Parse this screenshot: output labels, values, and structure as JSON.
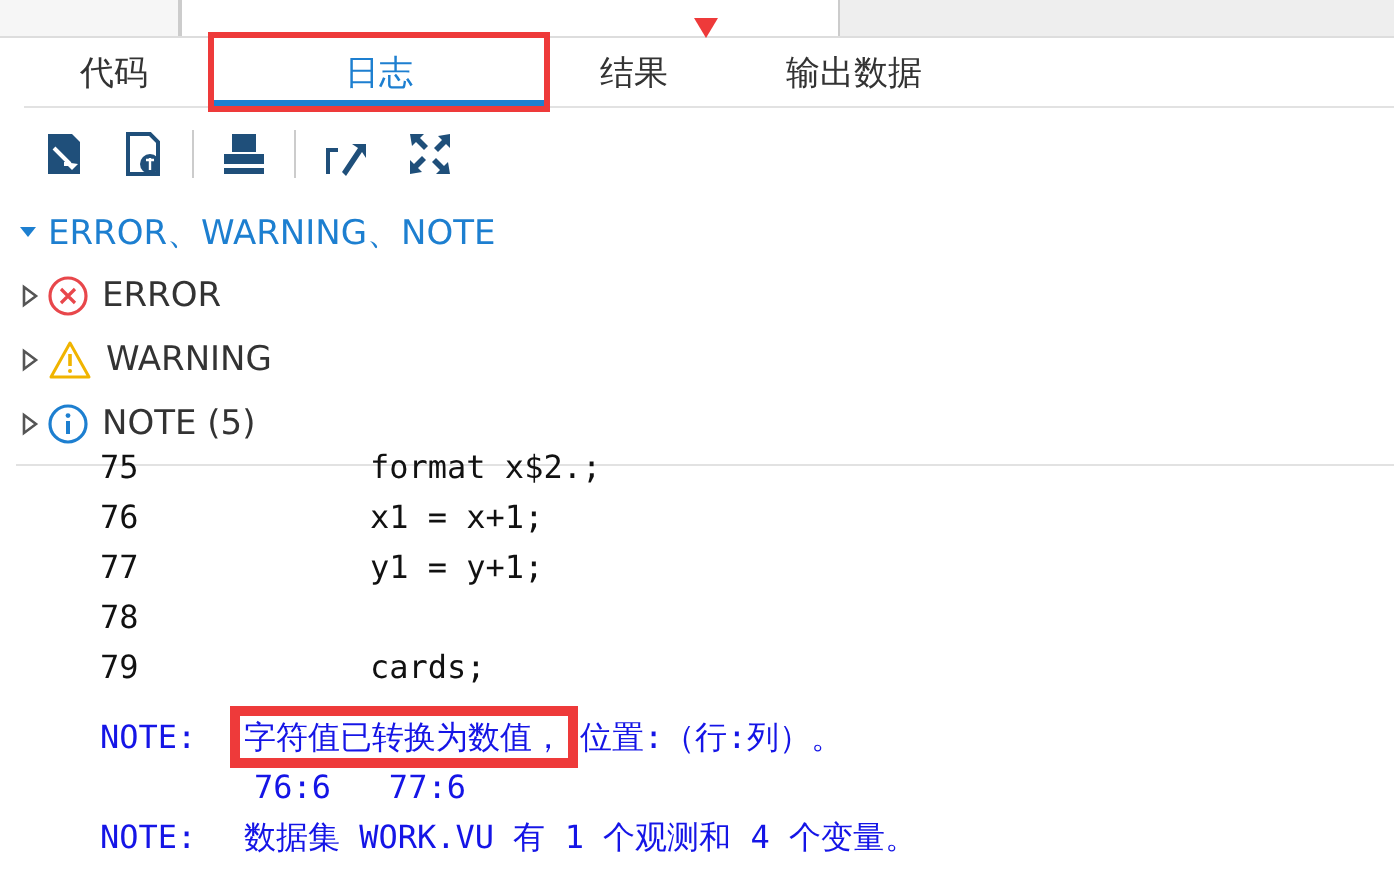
{
  "tabs": [
    {
      "label": "代码",
      "selected": false
    },
    {
      "label": "日志",
      "selected": true,
      "annotated": true
    },
    {
      "label": "结果",
      "selected": false
    },
    {
      "label": "输出数据",
      "selected": false
    }
  ],
  "summary": {
    "title": "ERROR、WARNING、NOTE",
    "expanded": true,
    "items": [
      {
        "kind": "error",
        "label": "ERROR",
        "expanded": false
      },
      {
        "kind": "warning",
        "label": "WARNING",
        "expanded": false
      },
      {
        "kind": "note",
        "label": "NOTE (5)",
        "expanded": false
      }
    ]
  },
  "log": [
    {
      "kind": "source",
      "number": "75",
      "code": "format x$2.;"
    },
    {
      "kind": "source",
      "number": "76",
      "code": "x1 = x+1;"
    },
    {
      "kind": "source",
      "number": "77",
      "code": "y1 = y+1;"
    },
    {
      "kind": "source",
      "number": "78"
    },
    {
      "kind": "source",
      "number": "79",
      "code": "cards;"
    },
    {
      "kind": "note",
      "label": "NOTE:",
      "segments": [
        {
          "text": "字符值已转换为数值，",
          "annotated": true
        },
        {
          "text": "位置:（行:列）。",
          "annotated": false
        }
      ]
    },
    {
      "kind": "detail",
      "text": "76:6   77:6"
    },
    {
      "kind": "note",
      "label": "NOTE:",
      "segments": [
        {
          "text": "数据集 WORK.VU 有 1 个观测和 4 个变量。",
          "annotated": false
        }
      ]
    }
  ]
}
